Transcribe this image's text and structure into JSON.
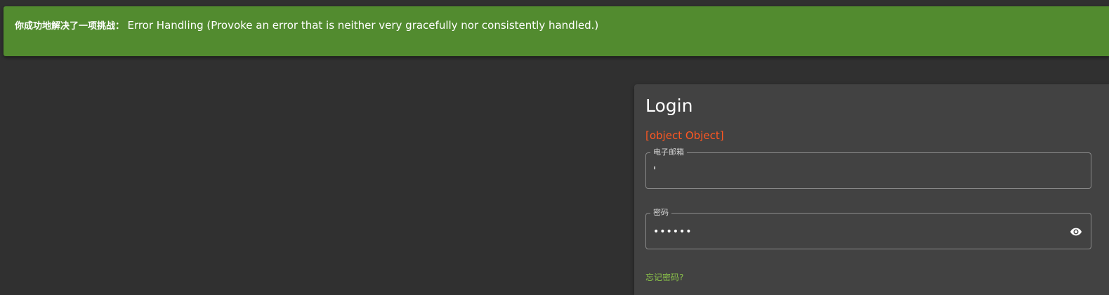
{
  "banner": {
    "prefix": "你成功地解决了一项挑战：",
    "message": "Error Handling (Provoke an error that is neither very gracefully nor consistently handled.)"
  },
  "login": {
    "title": "Login",
    "error": "[object Object]",
    "email": {
      "label": "电子邮箱",
      "value": "'"
    },
    "password": {
      "label": "密码",
      "value": "••••••",
      "toggle_icon": "eye-icon"
    },
    "forgot_link": "忘记密码?"
  },
  "colors": {
    "background": "#303030",
    "banner": "#528b2f",
    "card": "#424242",
    "error": "#ff5722",
    "link": "#8bc34a"
  }
}
